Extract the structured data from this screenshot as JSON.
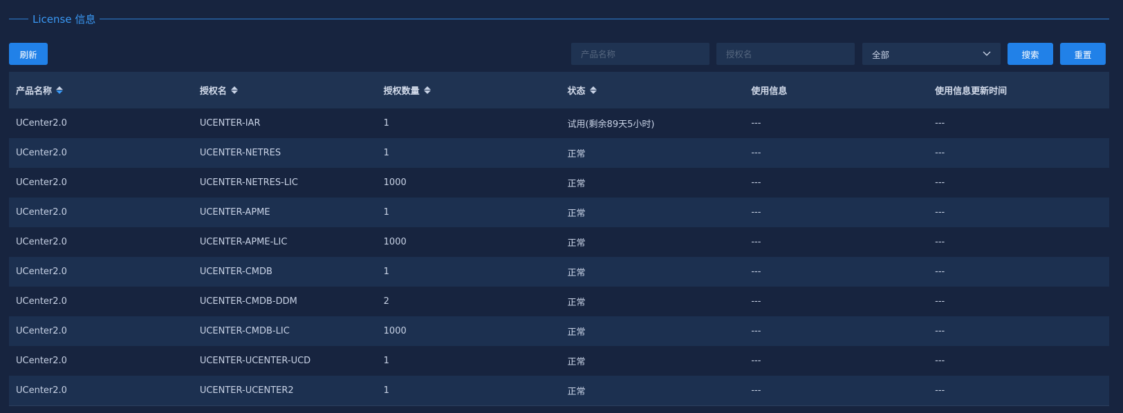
{
  "section": {
    "title": "License 信息"
  },
  "toolbar": {
    "refresh_label": "刷新",
    "product_placeholder": "产品名称",
    "auth_placeholder": "授权名",
    "status_select_value": "全部",
    "search_label": "搜索",
    "reset_label": "重置"
  },
  "table": {
    "columns": [
      "产品名称",
      "授权名",
      "授权数量",
      "状态",
      "使用信息",
      "使用信息更新时间"
    ],
    "rows": [
      [
        "UCenter2.0",
        "UCENTER-IAR",
        "1",
        "试用(剩余89天5小时)",
        "---",
        "---"
      ],
      [
        "UCenter2.0",
        "UCENTER-NETRES",
        "1",
        "正常",
        "---",
        "---"
      ],
      [
        "UCenter2.0",
        "UCENTER-NETRES-LIC",
        "1000",
        "正常",
        "---",
        "---"
      ],
      [
        "UCenter2.0",
        "UCENTER-APME",
        "1",
        "正常",
        "---",
        "---"
      ],
      [
        "UCenter2.0",
        "UCENTER-APME-LIC",
        "1000",
        "正常",
        "---",
        "---"
      ],
      [
        "UCenter2.0",
        "UCENTER-CMDB",
        "1",
        "正常",
        "---",
        "---"
      ],
      [
        "UCenter2.0",
        "UCENTER-CMDB-DDM",
        "2",
        "正常",
        "---",
        "---"
      ],
      [
        "UCenter2.0",
        "UCENTER-CMDB-LIC",
        "1000",
        "正常",
        "---",
        "---"
      ],
      [
        "UCenter2.0",
        "UCENTER-UCENTER-UCD",
        "1",
        "正常",
        "---",
        "---"
      ],
      [
        "UCenter2.0",
        "UCENTER-UCENTER2",
        "1",
        "正常",
        "---",
        "---"
      ]
    ]
  },
  "colors": {
    "background": "#17243f",
    "accent": "#2181e8",
    "title": "#3a99f5"
  },
  "icons": {
    "sort": "sort-icon",
    "select_arrow": "chevron-down-icon"
  }
}
